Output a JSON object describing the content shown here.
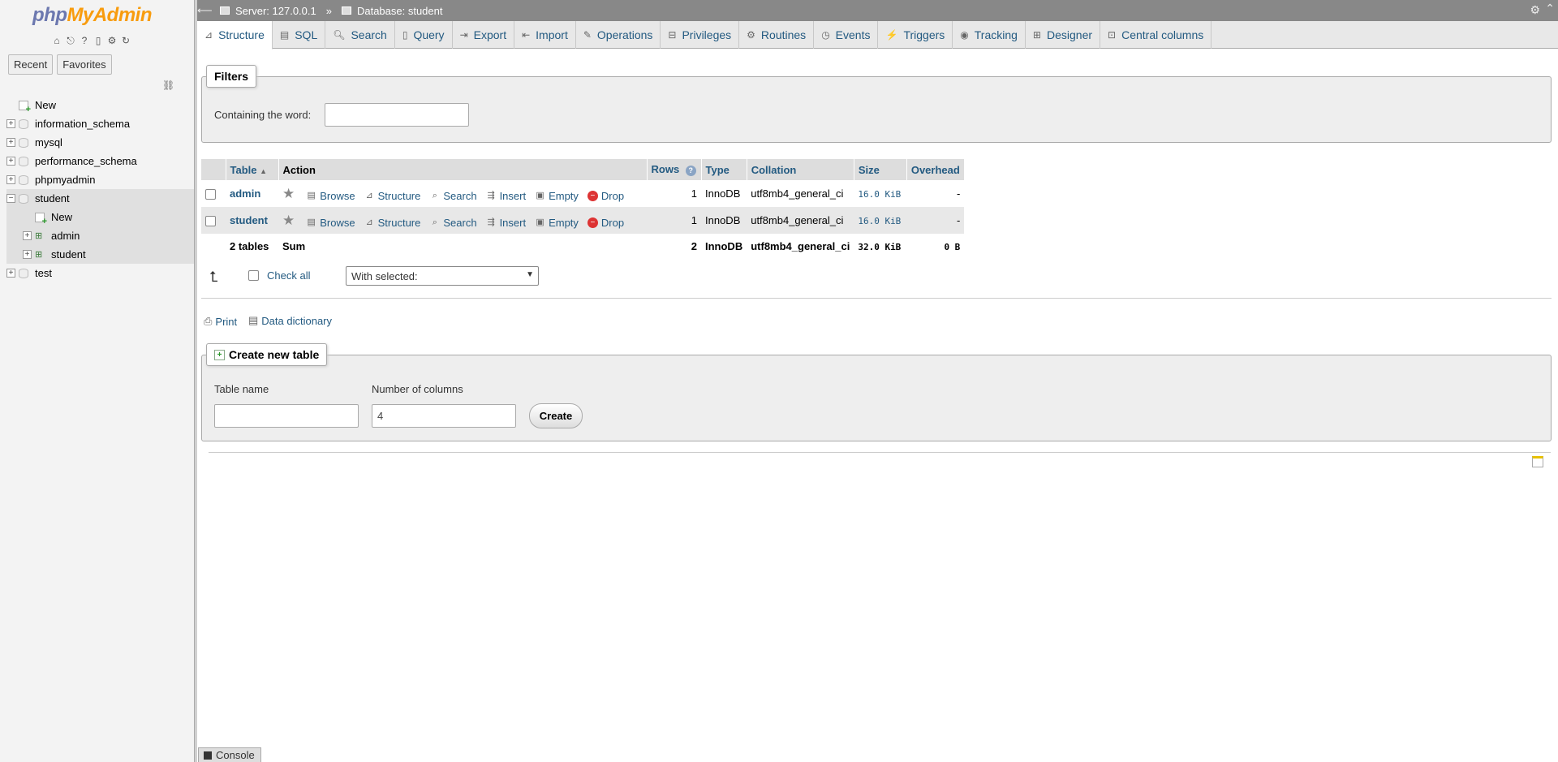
{
  "nav": {
    "logo_php": "php",
    "logo_admin": "MyAdmin",
    "tabs": [
      "Recent",
      "Favorites"
    ],
    "tree": [
      {
        "label": "New",
        "kind": "new",
        "level": 0
      },
      {
        "label": "information_schema",
        "kind": "db",
        "level": 0
      },
      {
        "label": "mysql",
        "kind": "db",
        "level": 0
      },
      {
        "label": "performance_schema",
        "kind": "db",
        "level": 0
      },
      {
        "label": "phpmyadmin",
        "kind": "db",
        "level": 0
      },
      {
        "label": "student",
        "kind": "db",
        "level": 0,
        "expanded": true,
        "selected": true
      },
      {
        "label": "New",
        "kind": "new",
        "level": 1
      },
      {
        "label": "admin",
        "kind": "table",
        "level": 1
      },
      {
        "label": "student",
        "kind": "table",
        "level": 1
      },
      {
        "label": "test",
        "kind": "db",
        "level": 0
      }
    ]
  },
  "breadcrumb": {
    "server": "Server: 127.0.0.1",
    "separator": "»",
    "database": "Database: student"
  },
  "menu": {
    "tabs": [
      "Structure",
      "SQL",
      "Search",
      "Query",
      "Export",
      "Import",
      "Operations",
      "Privileges",
      "Routines",
      "Events",
      "Triggers",
      "Tracking",
      "Designer",
      "Central columns"
    ],
    "active": "Structure"
  },
  "filters": {
    "legend": "Filters",
    "label": "Containing the word:",
    "value": ""
  },
  "table_list": {
    "headers": {
      "table": "Table",
      "action": "Action",
      "rows": "Rows",
      "type": "Type",
      "collation": "Collation",
      "size": "Size",
      "overhead": "Overhead"
    },
    "actions": [
      "Browse",
      "Structure",
      "Search",
      "Insert",
      "Empty",
      "Drop"
    ],
    "rows": [
      {
        "name": "admin",
        "rows": "1",
        "type": "InnoDB",
        "collation": "utf8mb4_general_ci",
        "size": "16.0 KiB",
        "overhead": "-"
      },
      {
        "name": "student",
        "rows": "1",
        "type": "InnoDB",
        "collation": "utf8mb4_general_ci",
        "size": "16.0 KiB",
        "overhead": "-"
      }
    ],
    "summary": {
      "tables": "2 tables",
      "label": "Sum",
      "rows": "2",
      "type": "InnoDB",
      "collation": "utf8mb4_general_ci",
      "size": "32.0 KiB",
      "overhead": "0 B"
    }
  },
  "bulk": {
    "check_all": "Check all",
    "with_selected": "With selected:"
  },
  "links": {
    "print": "Print",
    "data_dictionary": "Data dictionary"
  },
  "create_table": {
    "legend": "Create new table",
    "name_label": "Table name",
    "name_value": "",
    "columns_label": "Number of columns",
    "columns_value": "4",
    "button": "Create"
  },
  "console": {
    "label": "Console"
  }
}
